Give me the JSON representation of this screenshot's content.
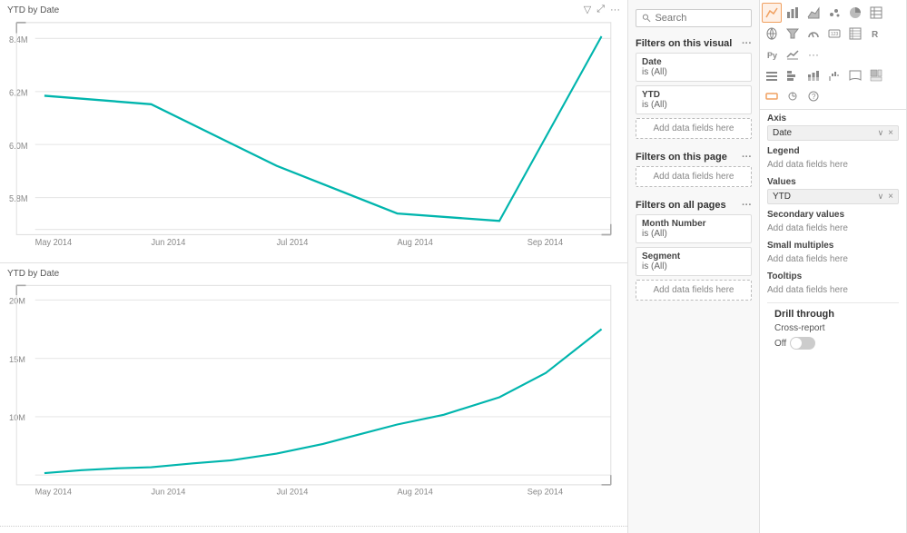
{
  "charts": {
    "top": {
      "title": "YTD by Date",
      "yLabels": [
        "8.4M",
        "6.2M",
        "6.0M",
        "5.8M"
      ],
      "xLabels": [
        "May 2014",
        "Jun 2014",
        "Jul 2014",
        "Aug 2014",
        "Sep 2014"
      ]
    },
    "bottom": {
      "title": "YTD by Date",
      "yLabels": [
        "20M",
        "15M",
        "10M"
      ],
      "xLabels": [
        "May 2014",
        "Jun 2014",
        "Jul 2014",
        "Aug 2014",
        "Sep 2014"
      ]
    }
  },
  "filters": {
    "search_placeholder": "Search",
    "visual_section": "Filters on this visual",
    "page_section": "Filters on this page",
    "allpages_section": "Filters on all pages",
    "visual_filters": [
      {
        "field": "Date",
        "value": "is (All)"
      },
      {
        "field": "YTD",
        "value": "is (All)"
      }
    ],
    "allpages_filters": [
      {
        "field": "Month Number",
        "value": "is (All)"
      },
      {
        "field": "Segment",
        "value": "is (All)"
      }
    ],
    "add_data_label": "Add data fields here"
  },
  "viz": {
    "axis_label": "Axis",
    "axis_field": "Date",
    "legend_label": "Legend",
    "values_label": "Values",
    "values_field": "YTD",
    "secondary_values_label": "Secondary values",
    "small_multiples_label": "Small multiples",
    "tooltips_label": "Tooltips",
    "add_data_label": "Add data fields here",
    "drill_through_label": "Drill through",
    "cross_report_label": "Cross-report",
    "off_label": "Off"
  },
  "icons": {
    "filter": "▽",
    "expand": "⤢",
    "more": "···",
    "search": "🔍",
    "close": "×",
    "chevron_down": "∨"
  }
}
